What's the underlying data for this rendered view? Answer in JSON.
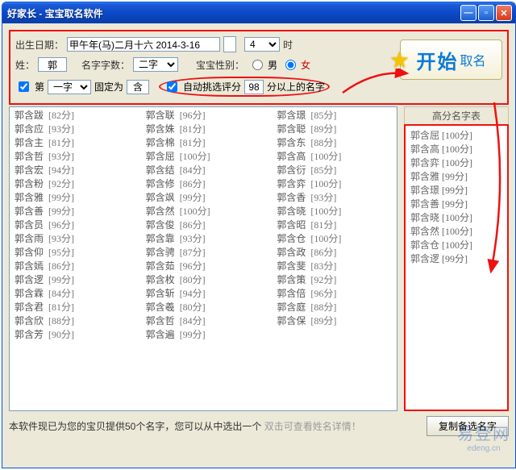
{
  "window": {
    "title": "好家长 - 宝宝取名软件"
  },
  "form": {
    "birth_label": "出生日期：",
    "birth_value": "甲午年(马)二月十六 2014-3-16",
    "hour_value": "4",
    "hour_suffix": "时",
    "surname_label": "姓：",
    "surname_value": "郭",
    "charcount_label": "名字字数：",
    "charcount_value": "二字",
    "gender_label": "宝宝性别：",
    "gender_male": "男",
    "gender_female": "女",
    "pos_prefix": "第",
    "pos_value": "一字",
    "fixed_label": "固定为",
    "fixed_value": "含",
    "auto_label": "自动挑选评分",
    "auto_score": "98",
    "auto_suffix": "分以上的名字"
  },
  "start": {
    "big": "开始",
    "small": "取名"
  },
  "columns": [
    [
      {
        "n": "郭含跋",
        "s": "82分"
      },
      {
        "n": "郭含应",
        "s": "93分"
      },
      {
        "n": "郭含主",
        "s": "81分"
      },
      {
        "n": "郭含哲",
        "s": "93分"
      },
      {
        "n": "郭含宏",
        "s": "94分"
      },
      {
        "n": "郭含粉",
        "s": "92分"
      },
      {
        "n": "郭含雅",
        "s": "99分"
      },
      {
        "n": "郭含善",
        "s": "99分"
      },
      {
        "n": "郭含员",
        "s": "96分"
      },
      {
        "n": "郭含雨",
        "s": "93分"
      },
      {
        "n": "郭含仰",
        "s": "95分"
      },
      {
        "n": "郭含嫣",
        "s": "86分"
      },
      {
        "n": "郭含逻",
        "s": "99分"
      },
      {
        "n": "郭含霖",
        "s": "84分"
      },
      {
        "n": "郭含君",
        "s": "81分"
      },
      {
        "n": "郭含欣",
        "s": "88分"
      },
      {
        "n": "郭含芳",
        "s": "90分"
      }
    ],
    [
      {
        "n": "郭含联",
        "s": "96分"
      },
      {
        "n": "郭含姝",
        "s": "81分"
      },
      {
        "n": "郭含棉",
        "s": "81分"
      },
      {
        "n": "郭含屈",
        "s": "100分"
      },
      {
        "n": "郭含结",
        "s": "84分"
      },
      {
        "n": "郭含修",
        "s": "86分"
      },
      {
        "n": "郭含飒",
        "s": "99分"
      },
      {
        "n": "郭含然",
        "s": "100分"
      },
      {
        "n": "郭含俊",
        "s": "86分"
      },
      {
        "n": "郭含靠",
        "s": "93分"
      },
      {
        "n": "郭含骋",
        "s": "87分"
      },
      {
        "n": "郭含茹",
        "s": "96分"
      },
      {
        "n": "郭含枚",
        "s": "80分"
      },
      {
        "n": "郭含斩",
        "s": "94分"
      },
      {
        "n": "郭含羲",
        "s": "80分"
      },
      {
        "n": "郭含哲",
        "s": "84分"
      },
      {
        "n": "郭含遍",
        "s": "99分"
      }
    ],
    [
      {
        "n": "郭含璟",
        "s": "85分"
      },
      {
        "n": "郭含聪",
        "s": "89分"
      },
      {
        "n": "郭含东",
        "s": "88分"
      },
      {
        "n": "郭含高",
        "s": "100分"
      },
      {
        "n": "郭含衍",
        "s": "85分"
      },
      {
        "n": "郭含弈",
        "s": "100分"
      },
      {
        "n": "郭含香",
        "s": "93分"
      },
      {
        "n": "郭含晓",
        "s": "100分"
      },
      {
        "n": "郭含昭",
        "s": "81分"
      },
      {
        "n": "郭含仓",
        "s": "100分"
      },
      {
        "n": "郭含政",
        "s": "86分"
      },
      {
        "n": "郭含斐",
        "s": "83分"
      },
      {
        "n": "郭含策",
        "s": "92分"
      },
      {
        "n": "郭含倍",
        "s": "96分"
      },
      {
        "n": "郭含庭",
        "s": "88分"
      },
      {
        "n": "郭含保",
        "s": "89分"
      }
    ]
  ],
  "sidebar": {
    "title": "高分名字表",
    "items": [
      {
        "n": "郭含屈",
        "s": "100分"
      },
      {
        "n": "郭含高",
        "s": "100分"
      },
      {
        "n": "郭含弈",
        "s": "100分"
      },
      {
        "n": "郭含雅",
        "s": "99分"
      },
      {
        "n": "郭含璟",
        "s": "99分"
      },
      {
        "n": "郭含善",
        "s": "99分"
      },
      {
        "n": "郭含晓",
        "s": "100分"
      },
      {
        "n": "郭含然",
        "s": "100分"
      },
      {
        "n": "郭含仓",
        "s": "100分"
      },
      {
        "n": "郭含逻",
        "s": "99分"
      }
    ]
  },
  "footer": {
    "tip_black": "本软件现已为您的宝贝提供50个名字，您可以从中选出一个",
    "tip_grey": "双击可查看姓名详情！",
    "copy_btn": "复制备选名字"
  },
  "watermark": {
    "line1": "易登网",
    "line2": "edeng.cn"
  }
}
